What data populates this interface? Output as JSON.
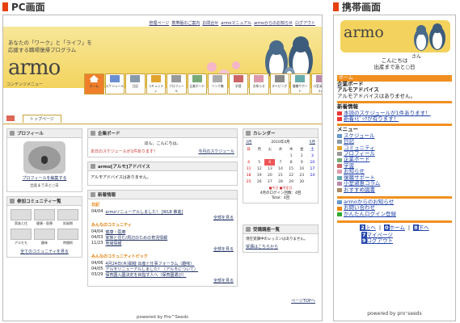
{
  "sections": {
    "pc": "PC画面",
    "mobile": "携帯画面"
  },
  "pc": {
    "top_links": [
      "管理ページ",
      "携帯版のご案内",
      "お問合せ",
      "armoマニュアル",
      "armoからのお知らせ",
      "ログアウト"
    ],
    "tagline1": "あなたの「ワーク」と「ライフ」を",
    "tagline2": "応援する職場復帰プログラム",
    "logo": "armo",
    "content_menu": "コンテンツメニュー",
    "menu": [
      "ホーム",
      "スケジュール",
      "日記",
      "コミュニティ",
      "プロフィール",
      "企業ボード",
      "リンク集",
      "学習",
      "お知らせ",
      "タイピング",
      "復職サポート",
      "小室淑恵コラム"
    ],
    "tab": "トップページ",
    "profile": {
      "title": "プロフィール",
      "edit_link": "プロフィールを編集する",
      "status": "出産まであと○日"
    },
    "community": {
      "title": "参加コミュニティ一覧",
      "items": [
        "",
        "",
        "",
        "家族と住",
        "健康・医療",
        "妊娠期",
        "",
        "",
        "",
        "アルモモ",
        "趣味",
        "時間術"
      ],
      "all_link": "全てのコミュニティを見る"
    },
    "board": {
      "title": "企業ボード",
      "greeting": "ほん、こんにちは。",
      "schedule_note": "本日のスケジュールが1件あります！",
      "schedule_link": "今月のスケジュール"
    },
    "advice": {
      "title": "armo[アルモ]アドバイス",
      "text": "アルモアドバイスはありません。"
    },
    "news": {
      "title": "新着情報",
      "diary_head": "日記",
      "diary_items": [
        {
          "date": "04/04",
          "text": "armoリニューアルしました！ [WLB 推進]"
        }
      ],
      "comm_head": "みんなのコミュニティ",
      "comm_items": [
        {
          "date": "04/04",
          "text": "健康・医療"
        },
        {
          "date": "04/03",
          "text": "家族と住む/周辺のための育児情報"
        },
        {
          "date": "11/23",
          "text": "地域情報"
        }
      ],
      "topic_head": "みんなのコミュニティトピック",
      "topic_items": [
        {
          "date": "04/06",
          "text": "4月24日(木)開催 出産と仕事フォーラム（趣味）"
        },
        {
          "date": "04/05",
          "text": "アルモリニューアルしました！（アルモについて）"
        },
        {
          "date": "03/29",
          "text": "保育園入園決定を目指す人へ（保育園選び）"
        }
      ],
      "all_link": "全部を見る"
    },
    "calendar": {
      "title": "カレンダー",
      "month": "2010年4月",
      "prev": "3月",
      "next": "5月",
      "days": [
        "日",
        "月",
        "火",
        "水",
        "木",
        "金",
        "土"
      ],
      "weeks": [
        [
          "",
          "",
          "",
          "",
          "1",
          "2",
          "3"
        ],
        [
          "4",
          "5",
          "6",
          "7",
          "8",
          "9",
          "10"
        ],
        [
          "11",
          "12",
          "13",
          "14",
          "15",
          "16",
          "17"
        ],
        [
          "18",
          "19",
          "20",
          "21",
          "22",
          "23",
          "24"
        ],
        [
          "25",
          "26",
          "27",
          "28",
          "29",
          "30",
          ""
        ]
      ],
      "legend": "■今日 ■予定日",
      "login_count": "4月のログイン回数：4回",
      "total": "Total：4回"
    },
    "learning": {
      "title": "受講講座一覧",
      "text": "現在受講中のレッスンはありません。",
      "link": "受講はこちらから"
    },
    "page_top": "ページTOPへ",
    "footer": "powered by Pro^Seeds"
  },
  "mobile": {
    "logo": "armo",
    "san": "さん",
    "hello": "こんにちは",
    "countdown": "出産まであと○日",
    "home": "ホーム",
    "board_head": "企業ボード",
    "advice_head": "アルモアドバイス",
    "advice_text": "アルモアドバイスはありません。",
    "news_head": "新着情報",
    "news_items": [
      "本読のスケジュールが1件あります！",
      "新着ﾄﾋﾟｯｸが有ります！"
    ],
    "menu_head": "メニュー",
    "menu_items": [
      "スケジュール",
      "日記",
      "コミュニティ",
      "プロフィール",
      "企業ボード",
      "学習",
      "お知らせ",
      "復職サポート",
      "小室淑恵コラム",
      "おすすめ図書"
    ],
    "extra_items": [
      "armoからのお知らせ",
      "お問い合わせ",
      "かんたんログイン登録"
    ],
    "nav": [
      "上へ",
      "ホーム",
      "下へ"
    ],
    "nav_keys": [
      "2",
      "0",
      "8"
    ],
    "my_page": "マイページ",
    "my_page_key": "7",
    "logout": "ログアウト",
    "logout_key": "9",
    "footer": "powered by pro⁺seeds"
  }
}
